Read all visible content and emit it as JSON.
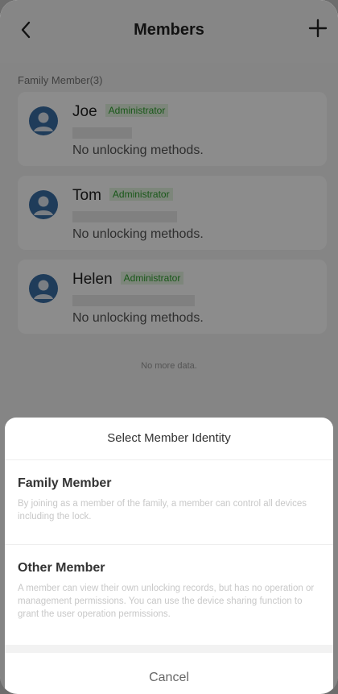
{
  "header": {
    "title": "Members",
    "back_icon": "chevron-left-icon",
    "add_icon": "plus-icon"
  },
  "members": {
    "section_label": "Family Member(3)",
    "items": [
      {
        "name": "Joe",
        "role": "Administrator",
        "status": "No unlocking methods."
      },
      {
        "name": "Tom",
        "role": "Administrator",
        "status": "No unlocking methods."
      },
      {
        "name": "Helen",
        "role": "Administrator",
        "status": "No unlocking methods."
      }
    ],
    "end_text": "No more data."
  },
  "sheet": {
    "title": "Select Member Identity",
    "options": [
      {
        "title": "Family Member",
        "description": "By joining as a member of the family, a member can control all devices including the lock."
      },
      {
        "title": "Other Member",
        "description": "A member can view their own unlocking records, but has no operation or management permissions. You can use the device sharing function to grant the user operation permissions."
      }
    ],
    "cancel_label": "Cancel"
  },
  "colors": {
    "badge_text": "#2c9e2c",
    "badge_bg": "#e4f4e0",
    "avatar": "#3a6ea5",
    "overlay": "rgba(0,0,0,0.45)"
  }
}
